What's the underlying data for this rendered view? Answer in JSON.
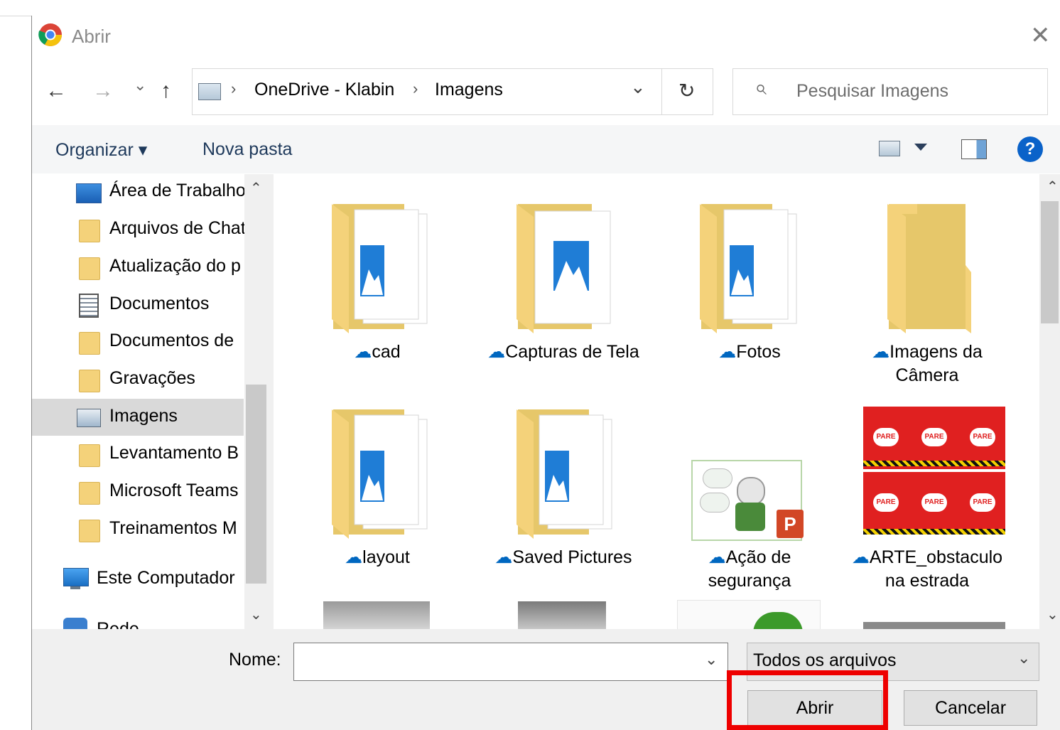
{
  "dialog": {
    "title": "Abrir",
    "close_glyph": "✕"
  },
  "nav": {
    "back": "←",
    "forward": "→",
    "recent": "⌄",
    "up": "↑"
  },
  "address": {
    "segments": [
      "OneDrive - Klabin",
      "Imagens"
    ],
    "separator": "›",
    "dropdown": "⌄",
    "refresh": "↻"
  },
  "search": {
    "placeholder": "Pesquisar Imagens",
    "icon": "⌕"
  },
  "toolbar": {
    "organize": "Organizar ▾",
    "new_folder": "Nova pasta",
    "help": "?"
  },
  "sidebar": {
    "items": [
      {
        "label": "Área de Trabalho",
        "icon": "desktop-icon"
      },
      {
        "label": "Arquivos de Chat",
        "icon": "folder-icon"
      },
      {
        "label": "Atualização do p",
        "icon": "folder-icon"
      },
      {
        "label": "Documentos",
        "icon": "document-icon"
      },
      {
        "label": "Documentos de",
        "icon": "folder-icon"
      },
      {
        "label": "Gravações",
        "icon": "folder-icon"
      },
      {
        "label": "Imagens",
        "icon": "pictures-icon",
        "selected": true
      },
      {
        "label": "Levantamento B",
        "icon": "folder-icon"
      },
      {
        "label": "Microsoft Teams",
        "icon": "folder-icon"
      },
      {
        "label": "Treinamentos M",
        "icon": "folder-icon"
      },
      {
        "label": "Este Computador",
        "icon": "computer-icon"
      },
      {
        "label": "Rede",
        "icon": "network-icon"
      }
    ]
  },
  "files": [
    {
      "name": "cad",
      "cloud": "☁",
      "kind": "pictures-folder"
    },
    {
      "name": "Capturas de Tela",
      "cloud": "☁",
      "kind": "pictures-folder"
    },
    {
      "name": "Fotos",
      "cloud": "☁",
      "kind": "pictures-folder"
    },
    {
      "name": "Imagens da Câmera",
      "cloud": "☁",
      "kind": "folder"
    },
    {
      "name": "layout",
      "cloud": "☁",
      "kind": "pictures-folder"
    },
    {
      "name": "Saved Pictures",
      "cloud": "☁",
      "kind": "pictures-folder"
    },
    {
      "name": "Ação de segurança",
      "cloud": "☁",
      "kind": "pptx"
    },
    {
      "name": "ARTE_obstaculo na estrada",
      "cloud": "☁",
      "kind": "image"
    }
  ],
  "thumb_text": {
    "pare": "PARE",
    "ppt": "P"
  },
  "footer": {
    "name_label": "Nome:",
    "name_value": "",
    "filetype": "Todos os arquivos",
    "open_button": "Abrir",
    "cancel_button": "Cancelar"
  },
  "colors": {
    "accent": "#1e395b",
    "highlight": "#ee0000",
    "folder": "#f4d27a",
    "help": "#0a62c9"
  }
}
